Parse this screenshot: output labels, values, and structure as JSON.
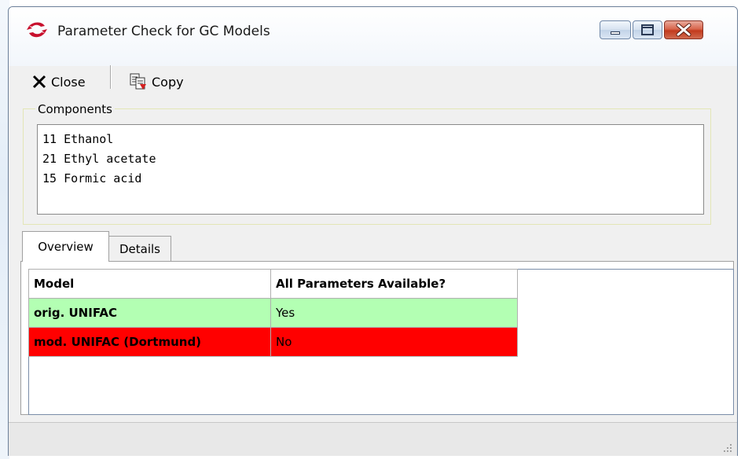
{
  "window": {
    "title": "Parameter Check for GC Models"
  },
  "toolbar": {
    "close_label": "Close",
    "copy_label": "Copy"
  },
  "components": {
    "label": "Components",
    "items": [
      "11 Ethanol",
      "21 Ethyl acetate",
      "15 Formic acid"
    ]
  },
  "tabs": [
    {
      "label": "Overview",
      "active": true
    },
    {
      "label": "Details",
      "active": false
    }
  ],
  "table": {
    "headers": [
      "Model",
      "All Parameters Available?"
    ],
    "rows": [
      {
        "model": "orig. UNIFAC",
        "available": "Yes",
        "status_color": "#b3ffb3"
      },
      {
        "model": "mod. UNIFAC (Dortmund)",
        "available": "No",
        "status_color": "#ff0000"
      }
    ]
  },
  "colors": {
    "yes_bg": "#b3ffb3",
    "no_bg": "#ff0000",
    "app_icon_red": "#c8102e"
  }
}
